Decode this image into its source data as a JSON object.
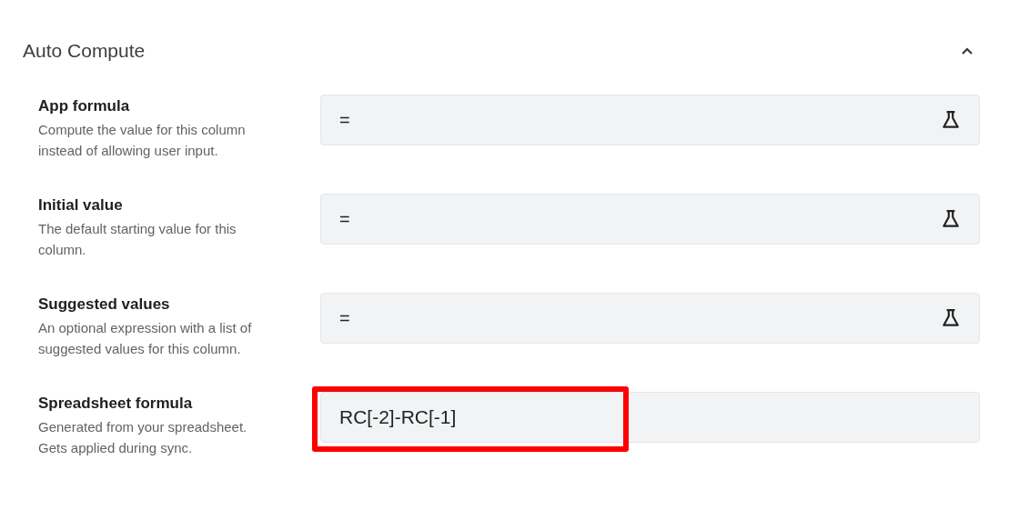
{
  "section": {
    "title": "Auto Compute",
    "expanded": true
  },
  "rows": [
    {
      "label": "App formula",
      "description": "Compute the value for this column instead of allowing user input.",
      "kind": "formula",
      "value": "=",
      "highlighted": false
    },
    {
      "label": "Initial value",
      "description": "The default starting value for this column.",
      "kind": "formula",
      "value": "=",
      "highlighted": false
    },
    {
      "label": "Suggested values",
      "description": "An optional expression with a list of suggested values for this column.",
      "kind": "formula",
      "value": "=",
      "highlighted": false
    },
    {
      "label": "Spreadsheet formula",
      "description": "Generated from your spreadsheet. Gets applied during sync.",
      "kind": "readonly",
      "value": "RC[-2]-RC[-1]",
      "highlighted": true
    }
  ]
}
